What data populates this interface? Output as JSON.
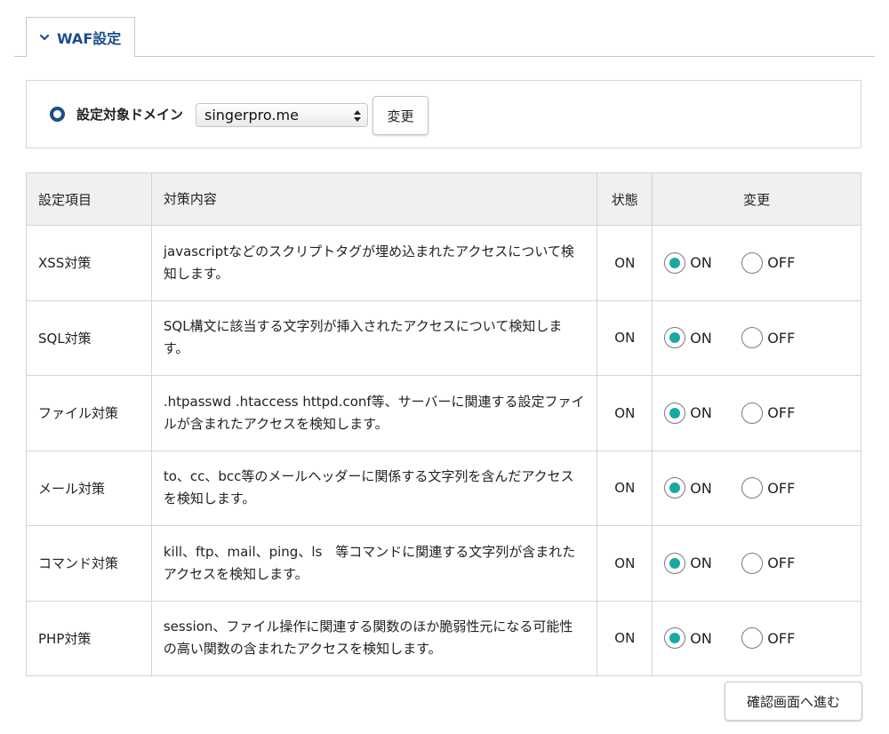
{
  "tab": {
    "label": "WAF設定",
    "icon": "chevron-down-icon"
  },
  "domain": {
    "label": "設定対象ドメイン",
    "selected": "singerpro.me",
    "change_button": "変更"
  },
  "table": {
    "headers": {
      "item": "設定項目",
      "desc": "対策内容",
      "status": "状態",
      "change": "変更"
    },
    "rows": [
      {
        "item": "XSS対策",
        "desc": "javascriptなどのスクリプトタグが埋め込まれたアクセスについて検知します。",
        "status": "ON",
        "on": "ON",
        "off": "OFF",
        "selected": "ON"
      },
      {
        "item": "SQL対策",
        "desc": "SQL構文に該当する文字列が挿入されたアクセスについて検知します。",
        "status": "ON",
        "on": "ON",
        "off": "OFF",
        "selected": "ON"
      },
      {
        "item": "ファイル対策",
        "desc": ".htpasswd .htaccess httpd.conf等、サーバーに関連する設定ファイルが含まれたアクセスを検知します。",
        "status": "ON",
        "on": "ON",
        "off": "OFF",
        "selected": "ON"
      },
      {
        "item": "メール対策",
        "desc": "to、cc、bcc等のメールヘッダーに関係する文字列を含んだアクセスを検知します。",
        "status": "ON",
        "on": "ON",
        "off": "OFF",
        "selected": "ON"
      },
      {
        "item": "コマンド対策",
        "desc": "kill、ftp、mail、ping、ls　等コマンドに関連する文字列が含まれたアクセスを検知します。",
        "status": "ON",
        "on": "ON",
        "off": "OFF",
        "selected": "ON"
      },
      {
        "item": "PHP対策",
        "desc": "session、ファイル操作に関連する関数のほか脆弱性元になる可能性の高い関数の含まれたアクセスを検知します。",
        "status": "ON",
        "on": "ON",
        "off": "OFF",
        "selected": "ON"
      }
    ]
  },
  "confirm_button": "確認画面へ進む",
  "colors": {
    "accent_blue": "#1d4e8c",
    "radio_teal": "#1aa9a0",
    "header_bg": "#f0f0f0"
  }
}
